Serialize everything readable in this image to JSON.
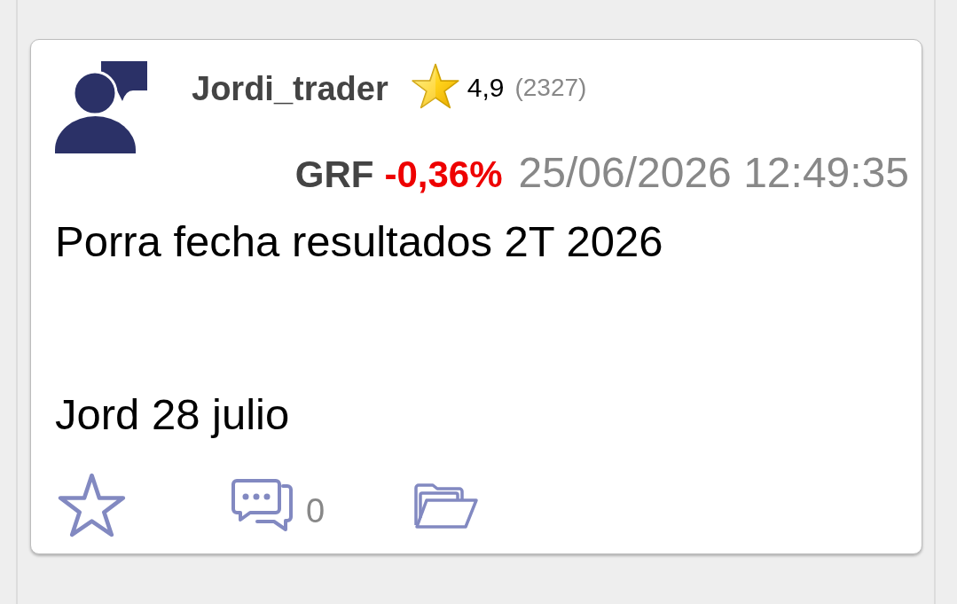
{
  "post": {
    "author": {
      "name": "Jordi_trader",
      "rating": "4,9",
      "rating_count": "(2327)"
    },
    "ticker": "GRF",
    "change": "-0,36%",
    "negative": true,
    "timestamp": "25/06/2026 12:49:35",
    "text": "Porra fecha resultados 2T 2026\n\n\nJord 28 julio",
    "actions": [
      {
        "kind": "favorite",
        "favorited": false
      },
      {
        "kind": "comments",
        "count": "0"
      },
      {
        "kind": "folder"
      }
    ]
  }
}
